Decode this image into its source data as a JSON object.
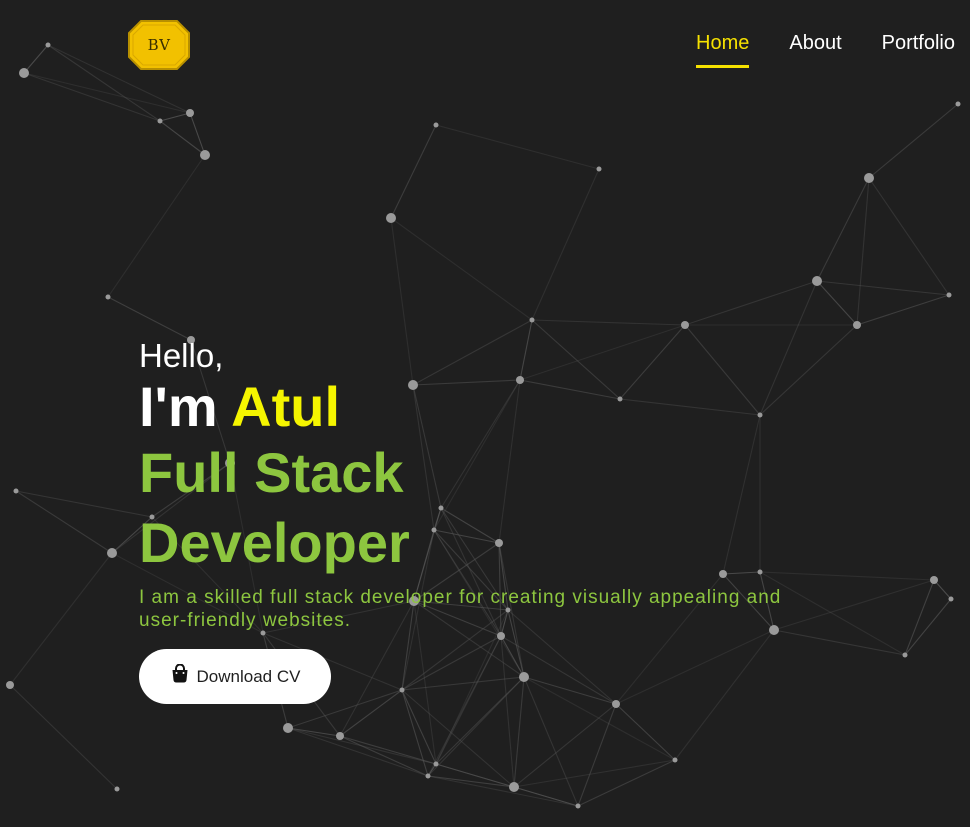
{
  "logo": {
    "text": "BV"
  },
  "nav": {
    "items": [
      {
        "label": "Home",
        "active": true
      },
      {
        "label": "About",
        "active": false
      },
      {
        "label": "Portfolio",
        "active": false
      }
    ]
  },
  "hero": {
    "greeting": "Hello,",
    "intro_prefix": "I'm",
    "name": "Atul",
    "role_line1": "Full Stack",
    "role_line2": "Developer",
    "description": "I am a skilled full stack developer for creating visually appealing and user-friendly websites.",
    "cta_label": "Download CV",
    "cta_icon": "shopping-bag-icon"
  },
  "colors": {
    "background": "#1f1f1f",
    "accent_yellow": "#f5e100",
    "accent_green": "#8dc63f",
    "text_white": "#ffffff",
    "logo_gold": "#f2c100"
  }
}
